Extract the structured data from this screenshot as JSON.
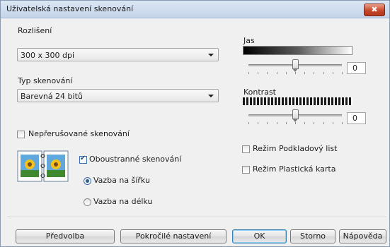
{
  "window": {
    "title": "Uživatelská nastavení skenování",
    "close_glyph": "✖"
  },
  "resolution": {
    "label": "Rozlišení",
    "value": "300 x 300 dpi"
  },
  "scan_type": {
    "label": "Typ skenování",
    "value": "Barevná 24 bitů"
  },
  "brightness": {
    "label": "Jas",
    "value": "0",
    "slider_position": 0.5
  },
  "contrast": {
    "label": "Kontrast",
    "value": "0",
    "slider_position": 0.5
  },
  "continuous_scan": {
    "label": "Nepřerušované skenování",
    "checked": false
  },
  "duplex": {
    "label": "Oboustranné skenování",
    "checked": true
  },
  "binding": {
    "options": [
      {
        "label": "Vazba na šířku",
        "selected": true
      },
      {
        "label": "Vazba na délku",
        "selected": false
      }
    ]
  },
  "carrier_sheet": {
    "label": "Režim Podkladový list",
    "checked": false
  },
  "plastic_card": {
    "label": "Režim Plastická karta",
    "checked": false
  },
  "buttons": {
    "preset": "Předvolba",
    "advanced": "Pokročilé nastavení",
    "ok": "OK",
    "cancel": "Storno",
    "help": "Nápověda"
  },
  "icons": {
    "close": "close-icon",
    "duplex_book": "duplex-book-icon",
    "combo_arrow": "chevron-down-icon"
  },
  "colors": {
    "accent": "#3c7fb1",
    "close_button": "#c7492c"
  }
}
